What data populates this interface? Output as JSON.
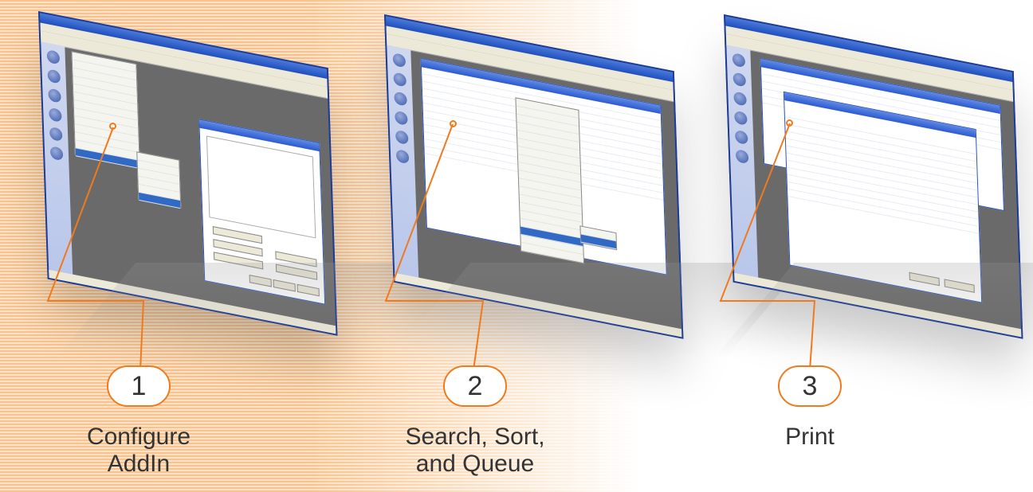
{
  "steps": [
    {
      "number": "1",
      "caption_line1": "Configure",
      "caption_line2": "AddIn"
    },
    {
      "number": "2",
      "caption_line1": "Search, Sort,",
      "caption_line2": "and Queue"
    },
    {
      "number": "3",
      "caption_line1": "Print",
      "caption_line2": ""
    }
  ],
  "icons": [
    "circle-marker-icon"
  ],
  "colors": {
    "accent": "#f07a1e",
    "window_blue": "#2a52be",
    "stripe_orange": "#f7c48f"
  }
}
